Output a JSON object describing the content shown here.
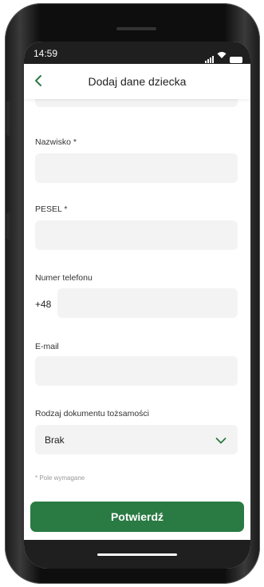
{
  "status_bar": {
    "time": "14:59"
  },
  "header": {
    "title": "Dodaj dane dziecka"
  },
  "form": {
    "surname": {
      "label": "Nazwisko *",
      "value": ""
    },
    "pesel": {
      "label": "PESEL *",
      "value": ""
    },
    "phone": {
      "label": "Numer telefonu",
      "prefix": "+48",
      "value": ""
    },
    "email": {
      "label": "E-mail",
      "value": ""
    },
    "document_type": {
      "label": "Rodzaj dokumentu tożsamości",
      "selected": "Brak"
    },
    "required_note": "* Pole wymagane"
  },
  "actions": {
    "confirm_label": "Potwierdź"
  },
  "colors": {
    "accent": "#2a7a43",
    "field_bg": "#f3f3f3",
    "bar": "#1f1f1f"
  },
  "icons": [
    "back-chevron-icon",
    "chevron-down-icon",
    "signal-icon",
    "wifi-icon",
    "battery-icon"
  ]
}
